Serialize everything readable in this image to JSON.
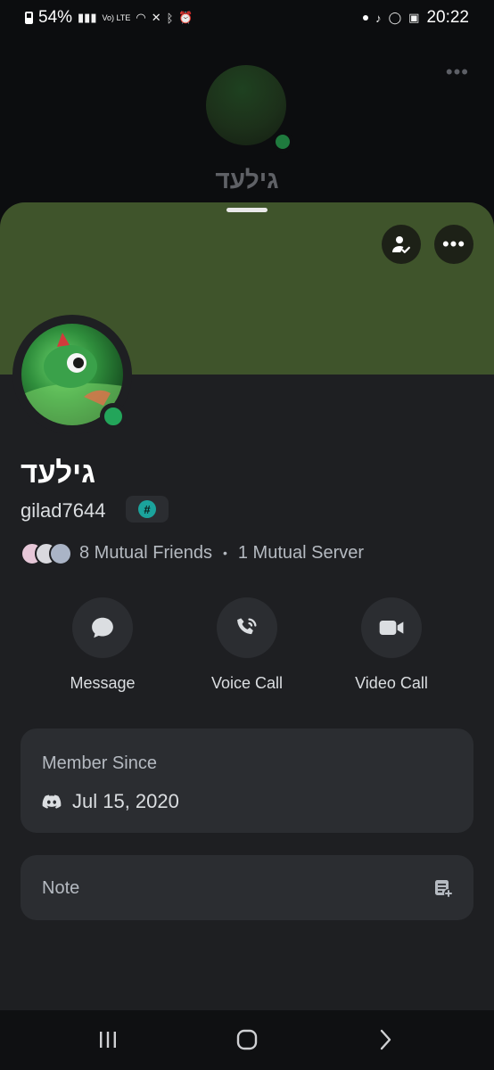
{
  "status_bar": {
    "battery": "54%",
    "network": "Vo) LTE",
    "time": "20:22"
  },
  "backdrop": {
    "name": "גילעד"
  },
  "profile": {
    "display_name": "גילעד",
    "username": "gilad7644",
    "badge_symbol": "#",
    "mutual_friends": "8 Mutual Friends",
    "mutual_servers": "1 Mutual Server",
    "separator": "•",
    "status": "online"
  },
  "actions": [
    {
      "label": "Message",
      "icon": "chat-bubble-icon"
    },
    {
      "label": "Voice Call",
      "icon": "phone-icon"
    },
    {
      "label": "Video Call",
      "icon": "video-camera-icon"
    }
  ],
  "member_since": {
    "title": "Member Since",
    "date": "Jul 15, 2020"
  },
  "note": {
    "title": "Note"
  },
  "colors": {
    "banner": "#3f542b",
    "online": "#23a55a",
    "sheet_bg": "#1e1f22",
    "card_bg": "#2b2d31"
  }
}
